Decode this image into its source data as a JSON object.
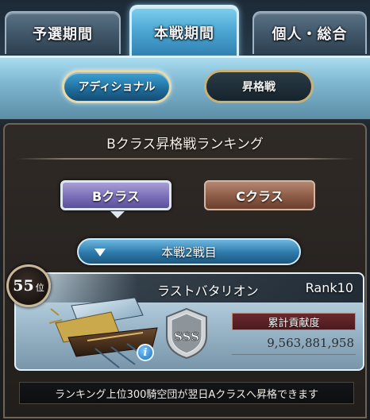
{
  "tabs": [
    {
      "label": "予選期間",
      "active": false
    },
    {
      "label": "本戦期間",
      "active": true
    },
    {
      "label": "個人・総合",
      "active": false
    }
  ],
  "modes": {
    "additional": "アディショナル",
    "promotion": "昇格戦"
  },
  "panel": {
    "title": "Bクラス昇格戦ランキング",
    "class_buttons": {
      "b": "Bクラス",
      "c": "Cクラス"
    },
    "round_select": "本戦2戦目"
  },
  "entry": {
    "rank_position": "55",
    "rank_unit": "位",
    "crew_name": "ラストバタリオン",
    "crew_rank": "Rank10",
    "grade": "SSS",
    "contribution_label": "累計貢献度",
    "contribution_value": "9,563,881,958"
  },
  "footer_note": "ランキング上位300騎空団が翌日Aクラスへ昇格できます",
  "colors": {
    "active_tab": "#4ea8d3",
    "b_class": "#7a6fb8",
    "c_class": "#8c5b46",
    "contribution_box": "#6b2a2f"
  }
}
